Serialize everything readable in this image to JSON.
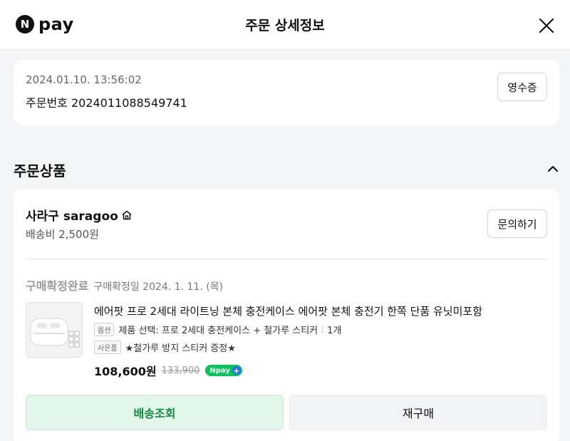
{
  "header": {
    "logo_badge": "N",
    "logo_text": "pay",
    "title": "주문 상세정보",
    "close_icon": "close-icon"
  },
  "order": {
    "datetime": "2024.01.10. 13:56:02",
    "order_number": "주문번호 2024011088549741",
    "receipt_button": "영수증"
  },
  "section": {
    "title": "주문상품",
    "collapse_icon": "chevron-up-icon"
  },
  "seller": {
    "name": "사라구 saragoo",
    "home_icon": "home-icon",
    "shipping_fee": "배송비 2,500원",
    "inquiry_button": "문의하기"
  },
  "product": {
    "status": "구매확정완료",
    "confirm_date": "구매확정일 2024. 1. 11. (목)",
    "name": "에어팟 프로 2세대 라이트닝 본체 충전케이스 에어팟 본체 충전기 한쪽 단품 유닛미포함",
    "option_tag": "옵션",
    "option_text": "제품 선택: 프로 2세대 충전케이스 + 철가루 스티커",
    "quantity": "1개",
    "gift_tag": "사은품",
    "gift_text": "★철가루 방지 스티커 증정★",
    "price": "108,600원",
    "original_price": "133,900",
    "npay_badge": "Npay",
    "npay_plus": "+"
  },
  "actions": {
    "track_button": "배송조회",
    "rebuy_button": "재구매"
  },
  "colors": {
    "accent_green": "#03c75a",
    "track_text": "#0f8a3f",
    "track_bg": "#e2f6ea"
  }
}
